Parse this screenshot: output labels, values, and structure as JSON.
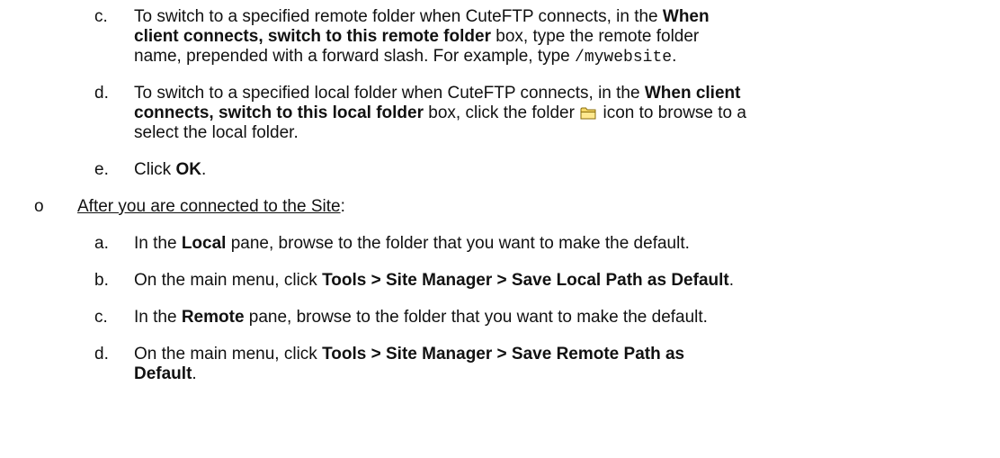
{
  "items": {
    "c1": {
      "marker": "c.",
      "l1_pre": "To switch to a specified remote folder when CuteFTP connects, in the ",
      "l1_bold": "When",
      "l2_bold": "client connects, switch to this remote folder",
      "l2_post": " box, type the remote folder",
      "l3_pre": "name, prepended with a forward slash. For example, type ",
      "l3_code": "/mywebsite",
      "l3_post": "."
    },
    "d1": {
      "marker": "d.",
      "l1_pre": "To switch to a specified local folder when CuteFTP connects, in the ",
      "l1_bold": "When client",
      "l2_bold": "connects, switch to this local folder",
      "l2_mid": " box, click the folder ",
      "l2_post": " icon to browse to a",
      "l3": "select the local folder.",
      "icon": "folder-icon"
    },
    "e1": {
      "marker": "e.",
      "pre": "Click ",
      "bold": "OK",
      "post": "."
    },
    "bullet": {
      "marker": "o",
      "text": "After you are connected to the Site",
      "post": ":"
    },
    "a2": {
      "marker": "a.",
      "pre": "In the ",
      "bold": "Local",
      "post": " pane, browse to the folder that you want to make the default."
    },
    "b2": {
      "marker": "b.",
      "pre": "On the main menu, click ",
      "bold": "Tools > Site Manager > Save Local Path as Default",
      "post": "."
    },
    "c2": {
      "marker": "c.",
      "pre": "In the ",
      "bold": "Remote",
      "post": " pane, browse to the folder that you want to make the default."
    },
    "d2": {
      "marker": "d.",
      "pre": "On the main menu, click ",
      "bold1": "Tools > Site Manager > Save Remote Path as",
      "bold2": "Default",
      "post": "."
    }
  }
}
